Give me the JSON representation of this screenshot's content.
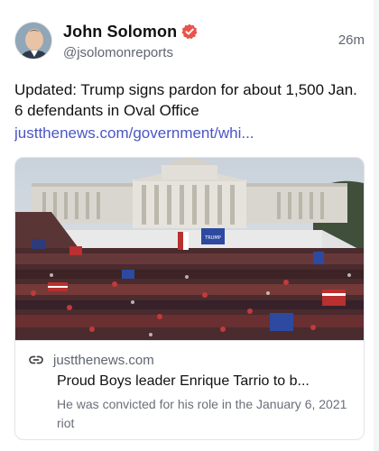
{
  "post": {
    "author_name": "John Solomon",
    "author_handle": "@jsolomonreports",
    "timestamp": "26m",
    "verified_icon": "verified-badge-icon",
    "accent_color": "#e8534a",
    "text": "Updated: Trump signs pardon for about 1,500 Jan. 6 defendants in Oval Office",
    "link_text": "justthenews.com/government/whi...",
    "link_color": "#4a55c7"
  },
  "card": {
    "domain": "justthenews.com",
    "link_icon": "link-icon",
    "title": "Proud Boys leader Enrique Tarrio to b...",
    "description": "He was convicted for his role in the January 6, 2021 riot",
    "image": {
      "sign_text": "TRUMP",
      "subject": "crowd at the Capitol building"
    }
  }
}
